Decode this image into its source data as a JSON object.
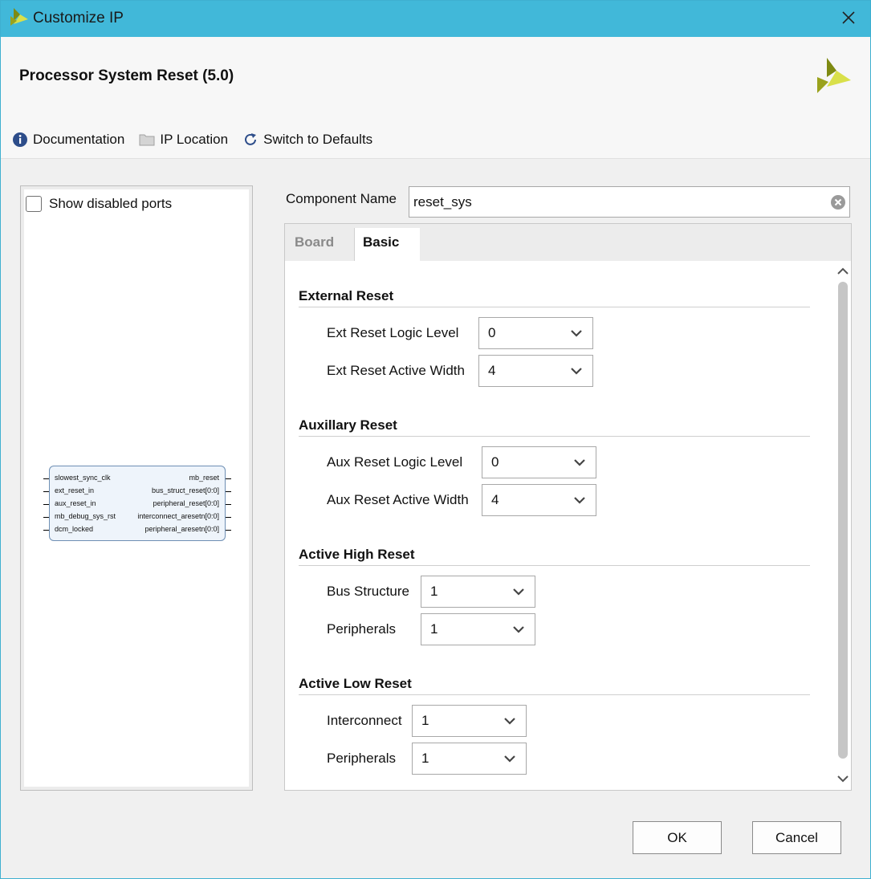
{
  "window": {
    "title": "Customize IP"
  },
  "header": {
    "ip_title": "Processor System Reset (5.0)"
  },
  "toolbar": {
    "documentation": "Documentation",
    "ip_location": "IP Location",
    "switch_defaults": "Switch to Defaults"
  },
  "left": {
    "show_disabled_ports": "Show disabled ports",
    "block": {
      "inputs": [
        "slowest_sync_clk",
        "ext_reset_in",
        "aux_reset_in",
        "mb_debug_sys_rst",
        "dcm_locked"
      ],
      "outputs": [
        "mb_reset",
        "bus_struct_reset[0:0]",
        "peripheral_reset[0:0]",
        "interconnect_aresetn[0:0]",
        "peripheral_aresetn[0:0]"
      ]
    }
  },
  "component": {
    "label": "Component Name",
    "value": "reset_sys"
  },
  "tabs": [
    {
      "label": "Board"
    },
    {
      "label": "Basic"
    }
  ],
  "sections": {
    "external": {
      "title": "External Reset",
      "logic_level_label": "Ext Reset Logic Level",
      "logic_level_value": "0",
      "active_width_label": "Ext Reset Active Width",
      "active_width_value": "4"
    },
    "auxiliary": {
      "title": "Auxillary Reset",
      "logic_level_label": "Aux Reset Logic Level",
      "logic_level_value": "0",
      "active_width_label": "Aux Reset Active Width",
      "active_width_value": "4"
    },
    "active_high": {
      "title": "Active High Reset",
      "bus_structure_label": "Bus Structure",
      "bus_structure_value": "1",
      "peripherals_label": "Peripherals",
      "peripherals_value": "1"
    },
    "active_low": {
      "title": "Active Low Reset",
      "interconnect_label": "Interconnect",
      "interconnect_value": "1",
      "peripherals_label": "Peripherals",
      "peripherals_value": "1"
    }
  },
  "buttons": {
    "ok": "OK",
    "cancel": "Cancel"
  },
  "colors": {
    "titlebar": "#41b8d9",
    "logo_dark": "#7e8a12",
    "logo_light": "#d9e04a"
  }
}
